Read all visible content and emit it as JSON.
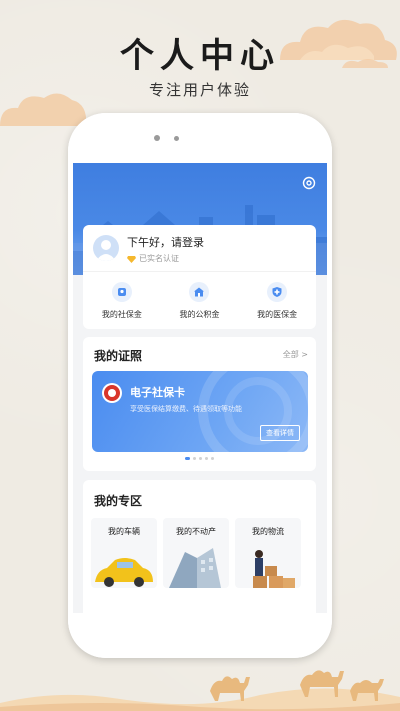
{
  "header": {
    "title": "个人中心",
    "subtitle": "专注用户体验"
  },
  "user": {
    "greeting": "下午好，请登录",
    "verify_status": "已实名认证"
  },
  "quick_links": [
    {
      "label": "我的社保金",
      "icon": "social-security-icon"
    },
    {
      "label": "我的公积金",
      "icon": "housing-fund-icon"
    },
    {
      "label": "我的医保金",
      "icon": "medical-insurance-icon"
    }
  ],
  "certificates": {
    "title": "我的证照",
    "all_link": "全部 >",
    "card": {
      "name": "电子社保卡",
      "description": "享受医保结算缴费、待遇领取等功能",
      "button": "查看详情"
    },
    "page_dots": 5,
    "active_dot": 0
  },
  "zone": {
    "title": "我的专区",
    "items": [
      {
        "label": "我的车辆"
      },
      {
        "label": "我的不动产"
      },
      {
        "label": "我的物流"
      }
    ]
  },
  "colors": {
    "accent": "#4a8cf0",
    "background": "#efebe3"
  }
}
